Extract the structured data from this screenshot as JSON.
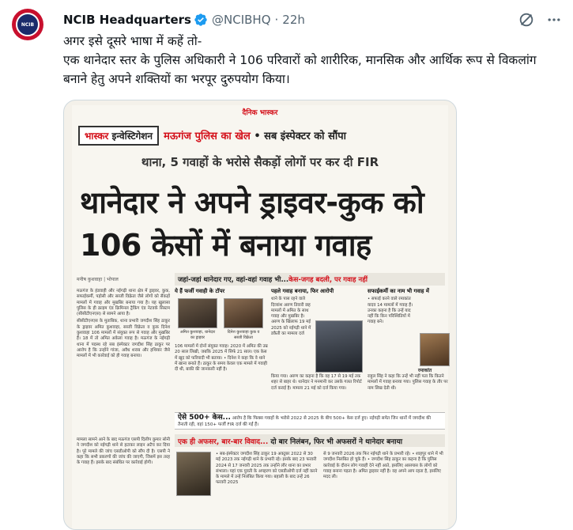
{
  "tweet": {
    "author_name": "NCIB Headquarters",
    "handle": "@NCIBHQ",
    "separator": "·",
    "time": "22h",
    "avatar_label": "NCIB",
    "lines": [
      "अगर इसे दूसरे भाषा में कहें तो-",
      "एक थानेदार स्तर के पुलिस अधिकारी ने 106 परिवारों को शारीरिक, मानसिक और आर्थिक रूप से विकलांग बनाने हेतु अपने शक्तियों का भरपूर दुरुपयोग किया।"
    ],
    "icons": {
      "verified": "verified-badge-icon",
      "grok": "grok-icon",
      "more": "more-icon"
    },
    "colors": {
      "verified": "#1d9bf0",
      "muted": "#536471",
      "accent_red": "#d4111b"
    }
  },
  "article": {
    "masthead": "दैनिक भास्कर",
    "section_tag_black": "भास्कर",
    "section_tag_red": "इन्वेस्टिगेशन",
    "kicker_red": "मऊगंज पुलिस का खेल",
    "kicker_black": "• सब इंस्पेक्टर को सौंपा",
    "subhead": "थाना, 5 गवाहों के भरोसे सैकड़ों लोगों पर कर दी FIR",
    "headline": "थानेदार ने अपने ड्राइवर-कुक को 106 केसों में बनाया गवाह",
    "byline": "मनीष कुशवाहा | भोपाल",
    "banner1_black": "जहां-जहां थानेदार गए, वहां-वहां गवाह भी...",
    "banner1_red": "केस-जगह बदली, पर गवाह नहीं",
    "left_col": [
      "मऊगंज के हंडवाही और नईगढ़ी थाना क्षेत्र में ड्राइवर, कुक, सफाईकर्मी, पड़ोसी और सब्जी विक्रेता जैसे लोगों को सैकड़ों मामलों में गवाह और मुखबिर बनाया गया है। यह खुलासा पुलिस के ही क्राइम एंड क्रिमिनल ट्रैकिंग एंड नेटवर्क सिस्टम (सीसीटीएनएस) से सामने आया है।",
      "सीसीटीएनएस के मुताबिक, थाना प्रभारी जगदीश सिंह ठाकुर के ड्राइवर अमित कुशवाहा, सब्जी विक्रेता व कुक दिनेश कुशवाहा 106 मामलों में संयुक्त रूप से गवाह और मुखबिर हैं। 18 में तो अमित अकेला गवाह है। मऊगंज के नईगढ़ी थाना में पदस्थ रहे सब इंस्पेक्टर जगदीश सिंह ठाकुर पर आरोप है कि उन्होंने गांजा, अवैध शराब और हथियार जैसे मामलों में भी कार्रवाई को ही गवाह बनाया।"
    ],
    "left_col2": "मामला सामने आने के बाद मऊगंज एसपी दिलीप कुमार सोनी ने जगदीश को नईगढ़ी थाने से हटाकर लाइन अटैच कर दिया है। पूरे मामले की जांच एसडीओपी को सौंप दी है। एसपी ने कहा कि सभी प्रकरणों की जांच की जाएगी, जिसमें इस तरह के गवाह हैं। इसके बाद संबंधित पर कार्रवाई होगी।",
    "panel1": {
      "title": "ये हैं फर्जी गवाही के टॉपर",
      "caption_a": "अमित कुशवाहा, थानेदार का ड्राइवर",
      "caption_b": "दिनेश कुशवाहा कुक व सब्जी विक्रेता",
      "body": "106 मामलों में दोनों संयुक्त गवाह। 2020 में अमित की उम्र 20 साल लिखी, जबकि 2025 में सिर्फ 21 साल। एक केस में खुद को फरियादी भी बताया।",
      "body2": "• दिनेश ने कहा कि वे थाने में खाना बनाते हैं। ठाकुर के समय केवल एक मामले में गवाही दी थी, बाकी की जानकारी नहीं है।"
    },
    "panel2": {
      "title": "पहले गवाह बनाया, फिर आरोपी",
      "txt": "थाने के पास रहने वाले दिव्यांश अरुण तिवारी छह मामलों में अमित के साथ गवाह और मुखबिर है। अरुण के खिलाफ 19 मई 2025 को नईगढ़ी थाने में डकैती का मामला दर्ज",
      "bottom": "किया गया। अरुण का कहना है कि वह 17 से 19 मई तक शहर से बाहर थे। थानेदार ने मनमानी कर उसके गलत रिपोर्ट दर्ज कराई है। मामला 21 मई को दर्ज किया गया।"
    },
    "panel3": {
      "title": "सफाईकर्मी का नाम भी गवाह में",
      "txt": "• सफाई करने वाले रमाकांत यादव 14 मामलों में गवाह हैं। उनका कहना है कि उन्हें याद नहीं कि किन परिस्थितियों में गवाह बने।",
      "caption": "रमाकांत",
      "bottom": "राहुल सिंह ने कहा कि उन्हें भी नहीं पता कि कितने मामलों में गवाह बनाया गया। पुलिस गवाह के तौर पर नाम लिख देती थी।"
    },
    "strip_bold": "ऐसे 500+ केस...",
    "strip_text": "आरोप है कि फिक्स गवाहों के भरोसे 2022 से 2025 के बीच 500+ केस दर्ज हुए। नईगढ़ी समेत जिन थानों में जगदीश की तैनाती रही, वहां 150+ फर्जी FIR दर्ज की गईं हैं।",
    "banner2_red": "एक ही अफसर, बार-बार विवाद...",
    "banner2_black": "दो बार निलंबन, फिर भी अफसरों ने थानेदार बनाया",
    "bottom_col1": "• सब-इंस्पेक्टर जगदीश सिंह ठाकुर 19 अक्टूबर 2022 से 30 मई 2023 तक नईगढ़ी थाने के प्रभारी रहे। इसके बाद 23 फरवरी 2024 से 17 जनवरी 2025 तक उन्होंने लौर थाना का प्रभार संभाला। यहां एक युवती के अपहरण को एसडीओपी दर्ज नहीं करने के मामले में उन्हें निलंबित किया गया। बहाली के बाद उन्हें 26 फरवरी 2025",
    "bottom_col2": "से 9 जनवरी 2026 तक फिर नईगढ़ी थाने के प्रभारी रहे। • शाहपुर थाने में भी जगदीश निलंबित हो चुके हैं। • जगदीश सिंह ठाकुर का कहना है कि पुलिस कार्रवाई के दौरान लोग गवाही देने नहीं आते, इसलिए आसपास के लोगों को गवाह बनाना पड़ता है। अमित ड्राइवर नहीं है। वह अपने आप रहता है, इसलिए मदद ली।"
  }
}
